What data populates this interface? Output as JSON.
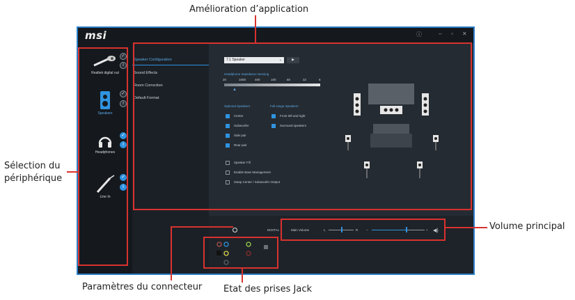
{
  "callouts": {
    "app_enhancement": "Amélioration d’application",
    "device_selection": "Sélection du\npériphérique",
    "main_volume": "Volume principal",
    "connector_settings": "Paramètres du connecteur",
    "jack_status": "Etat des prises Jack"
  },
  "app": {
    "logo": "msi",
    "devices": [
      {
        "label": "Realtek digital out"
      },
      {
        "label": "Speakers"
      },
      {
        "label": "Headphones"
      },
      {
        "label": "Line In"
      }
    ],
    "tabs": [
      "Speaker Configuration",
      "Sound Effects",
      "Room Correction",
      "Default Format"
    ],
    "speaker_select": "7.1 Speaker",
    "impedance": {
      "title": "Headphone Impedance Sensing",
      "ticks": [
        "20",
        "1000",
        "400",
        "100",
        "60",
        "32",
        "8"
      ]
    },
    "optional_title": "Optional Speakers",
    "optional": [
      "Center",
      "Subwoofer",
      "Side pair",
      "Rear pair"
    ],
    "fullrange_title": "Full-range Speakers",
    "fullrange": [
      "Front left and right",
      "Surround speakers"
    ],
    "extras": [
      "Speaker Fill",
      "Enable Bass Management",
      "Swap Center / Subwoofer Output"
    ],
    "digital_label": "DIGITAL",
    "main_volume_label": "Main Volume",
    "volume_L": "L",
    "volume_R": "R",
    "volume_level": 0.65,
    "balance": 0.5,
    "colors": {
      "accent": "#2f93e0",
      "callout_red": "#d9322f",
      "window_border": "#2c7fc8"
    }
  }
}
